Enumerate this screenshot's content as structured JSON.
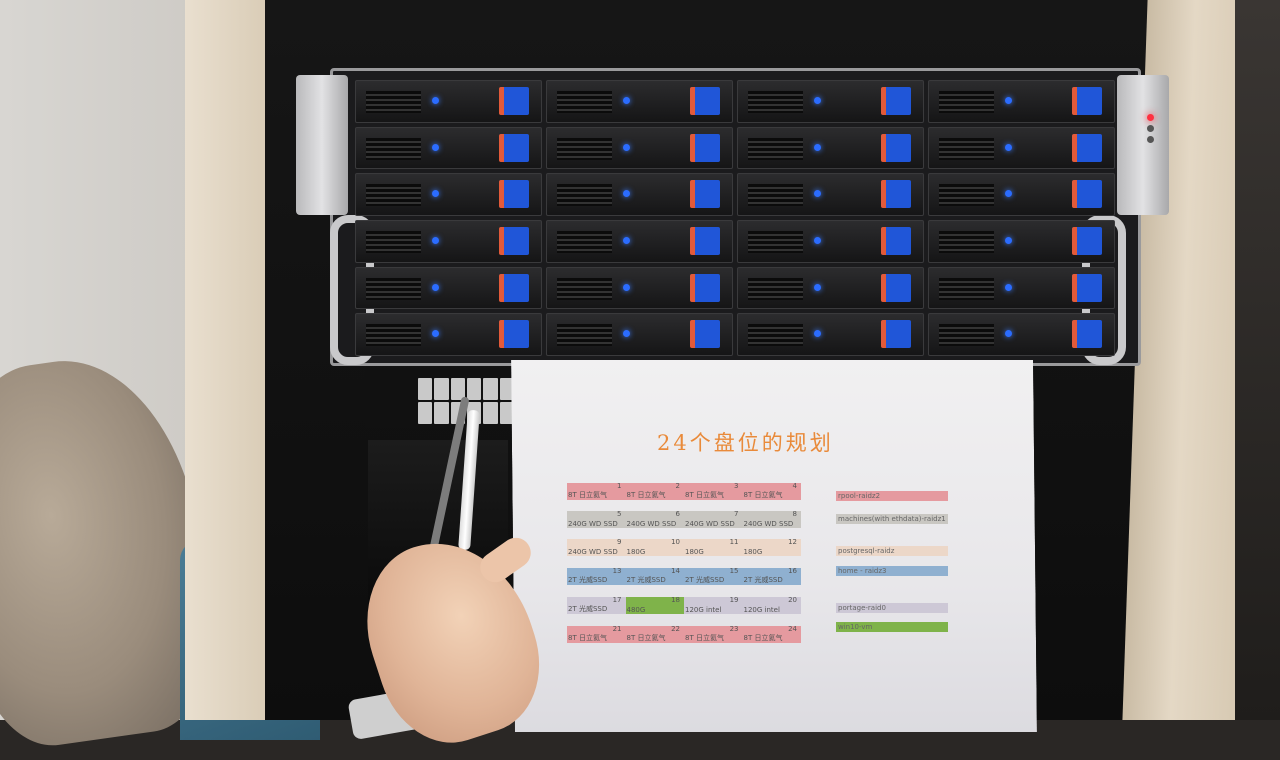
{
  "paper": {
    "title": "24个盘位的规划",
    "rows": [
      {
        "color": "#e59a9f",
        "cells": [
          {
            "num": "1",
            "label": "8T 日立氦气"
          },
          {
            "num": "2",
            "label": "8T 日立氦气"
          },
          {
            "num": "3",
            "label": "8T 日立氦气"
          },
          {
            "num": "4",
            "label": "8T 日立氦气"
          }
        ]
      },
      {
        "color": "#c9c7c2",
        "cells": [
          {
            "num": "5",
            "label": "240G WD SSD"
          },
          {
            "num": "6",
            "label": "240G WD SSD"
          },
          {
            "num": "7",
            "label": "240G WD SSD"
          },
          {
            "num": "8",
            "label": "240G WD SSD"
          }
        ]
      },
      {
        "color": "#ecd7c8",
        "cells": [
          {
            "num": "9",
            "label": "240G WD SSD"
          },
          {
            "num": "10",
            "label": "180G"
          },
          {
            "num": "11",
            "label": "180G"
          },
          {
            "num": "12",
            "label": "180G"
          }
        ]
      },
      {
        "color": "#8fb0d0",
        "cells": [
          {
            "num": "13",
            "label": "2T 光威SSD"
          },
          {
            "num": "14",
            "label": "2T 光威SSD"
          },
          {
            "num": "15",
            "label": "2T 光威SSD"
          },
          {
            "num": "16",
            "label": "2T 光威SSD"
          }
        ]
      },
      {
        "color": "#cdc8d6",
        "cells": [
          {
            "num": "17",
            "label": "2T 光威SSD"
          },
          {
            "num": "18",
            "label": "480G",
            "color": "#7fb34a"
          },
          {
            "num": "19",
            "label": "120G intel"
          },
          {
            "num": "20",
            "label": "120G intel"
          }
        ]
      },
      {
        "color": "#e59a9f",
        "cells": [
          {
            "num": "21",
            "label": "8T 日立氦气"
          },
          {
            "num": "22",
            "label": "8T 日立氦气"
          },
          {
            "num": "23",
            "label": "8T 日立氦气"
          },
          {
            "num": "24",
            "label": "8T 日立氦气"
          }
        ]
      }
    ],
    "legend": [
      {
        "label": "rpool-raidz2",
        "color": "#e59a9f"
      },
      {
        "label": "machines(with ethdata)-raidz1",
        "color": "#c9c7c2"
      },
      {
        "label": "postgresql-raidz",
        "color": "#ecd7c8"
      },
      {
        "label": "home - raidz3",
        "color": "#8fb0d0"
      },
      {
        "label": "portage-raid0",
        "color": "#cdc8d6"
      },
      {
        "label": "win10-vm",
        "color": "#7fb34a"
      }
    ]
  }
}
